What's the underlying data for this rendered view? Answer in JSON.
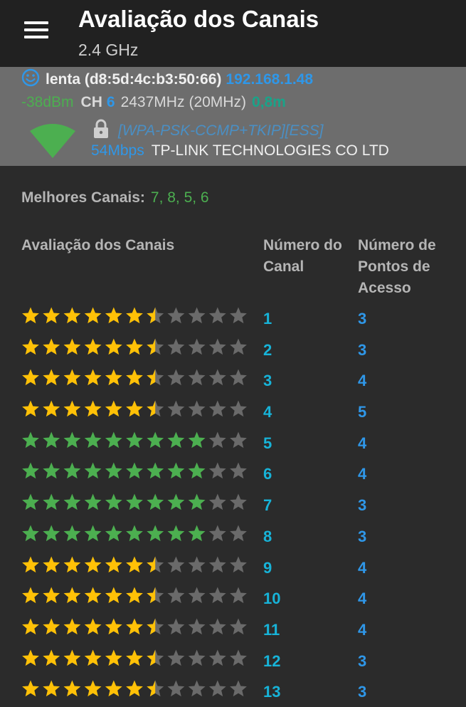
{
  "app": {
    "title": "Avaliação dos Canais",
    "subtitle": "2.4 GHz"
  },
  "icons": {
    "menu": "hamburger-menu-icon",
    "status": "smiley-face-icon",
    "lock": "lock-icon",
    "signal": "wifi-signal-icon"
  },
  "connection": {
    "ssid": "lenta (d8:5d:4c:b3:50:66)",
    "ip": "192.168.1.48",
    "signal": "-38dBm",
    "channel_label": "CH",
    "channel": "6",
    "frequency": "2437MHz",
    "width": "(20MHz)",
    "distance": "0,8m",
    "security": "[WPA-PSK-CCMP+TKIP][ESS]",
    "speed": "54Mbps",
    "vendor": "TP-LINK TECHNOLOGIES CO LTD"
  },
  "best_channels": {
    "label": "Melhores Canais:",
    "value": "7, 8, 5, 6"
  },
  "table": {
    "headers": {
      "rating": "Avaliação dos Canais",
      "channel": "Número do Canal",
      "access_points": "Número de Pontos de Acesso"
    },
    "max_stars": 11,
    "rows": [
      {
        "channel": "1",
        "access_points": "3",
        "rating": 6.5,
        "color": "#ffc107"
      },
      {
        "channel": "2",
        "access_points": "3",
        "rating": 6.5,
        "color": "#ffc107"
      },
      {
        "channel": "3",
        "access_points": "4",
        "rating": 6.5,
        "color": "#ffc107"
      },
      {
        "channel": "4",
        "access_points": "5",
        "rating": 6.5,
        "color": "#ffc107"
      },
      {
        "channel": "5",
        "access_points": "4",
        "rating": 9,
        "color": "#4caf50"
      },
      {
        "channel": "6",
        "access_points": "4",
        "rating": 9,
        "color": "#4caf50"
      },
      {
        "channel": "7",
        "access_points": "3",
        "rating": 9,
        "color": "#4caf50"
      },
      {
        "channel": "8",
        "access_points": "3",
        "rating": 9,
        "color": "#4caf50"
      },
      {
        "channel": "9",
        "access_points": "4",
        "rating": 6.5,
        "color": "#ffc107"
      },
      {
        "channel": "10",
        "access_points": "4",
        "rating": 6.5,
        "color": "#ffc107"
      },
      {
        "channel": "11",
        "access_points": "4",
        "rating": 6.5,
        "color": "#ffc107"
      },
      {
        "channel": "12",
        "access_points": "3",
        "rating": 6.5,
        "color": "#ffc107"
      },
      {
        "channel": "13",
        "access_points": "3",
        "rating": 6.5,
        "color": "#ffc107"
      }
    ]
  },
  "colors": {
    "empty_star": "#6a6a6a",
    "accent_blue": "#2f97e8",
    "accent_green": "#4caf50"
  }
}
